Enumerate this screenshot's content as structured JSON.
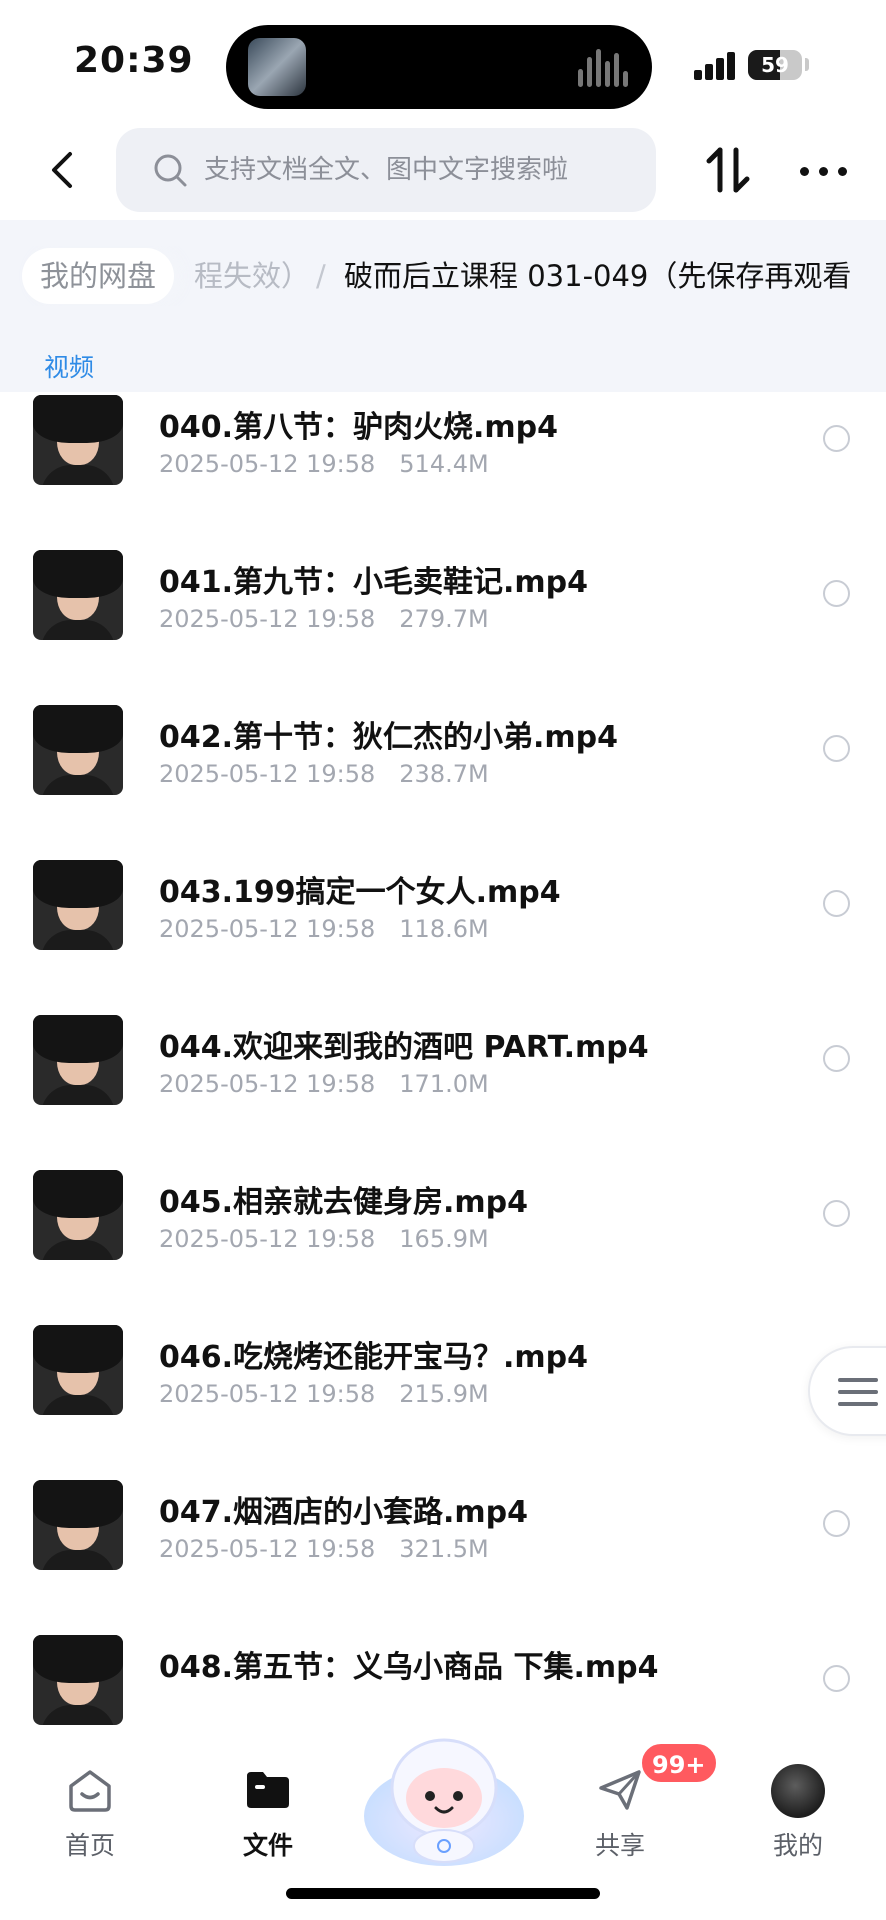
{
  "status_bar": {
    "time": "20:39",
    "battery_level": 59,
    "battery_text": "59"
  },
  "nav": {
    "search_placeholder": "支持文档全文、图中文字搜索啦"
  },
  "breadcrumb": {
    "root": "我的网盘",
    "previous": "程失效）",
    "separator": "/",
    "current": "破而后立课程 031-049（先保存再观看"
  },
  "section_label": "视频",
  "files": [
    {
      "name": "040.第八节：驴肉火烧.mp4",
      "date": "2025-05-12 19:58",
      "size": "514.4M"
    },
    {
      "name": "041.第九节：小毛卖鞋记.mp4",
      "date": "2025-05-12 19:58",
      "size": "279.7M"
    },
    {
      "name": "042.第十节：狄仁杰的小弟.mp4",
      "date": "2025-05-12 19:58",
      "size": "238.7M"
    },
    {
      "name": "043.199搞定一个女人.mp4",
      "date": "2025-05-12 19:58",
      "size": "118.6M"
    },
    {
      "name": "044.欢迎来到我的酒吧 PART.mp4",
      "date": "2025-05-12 19:58",
      "size": "171.0M"
    },
    {
      "name": "045.相亲就去健身房.mp4",
      "date": "2025-05-12 19:58",
      "size": "165.9M"
    },
    {
      "name": "046.吃烧烤还能开宝马？.mp4",
      "date": "2025-05-12 19:58",
      "size": "215.9M"
    },
    {
      "name": "047.烟酒店的小套路.mp4",
      "date": "2025-05-12 19:58",
      "size": "321.5M"
    },
    {
      "name": "048.第五节：义乌小商品 下集.mp4",
      "date": "",
      "size": ""
    }
  ],
  "tabs": [
    {
      "label": "首页",
      "icon": "home-icon"
    },
    {
      "label": "文件",
      "icon": "folder-icon"
    },
    {
      "label": "共享",
      "icon": "send-icon",
      "badge": "99+"
    },
    {
      "label": "我的",
      "icon": "avatar"
    }
  ],
  "colors": {
    "accent": "#2f8be6",
    "badge": "#ff5a5f",
    "meta_text": "#a3a7b0"
  }
}
